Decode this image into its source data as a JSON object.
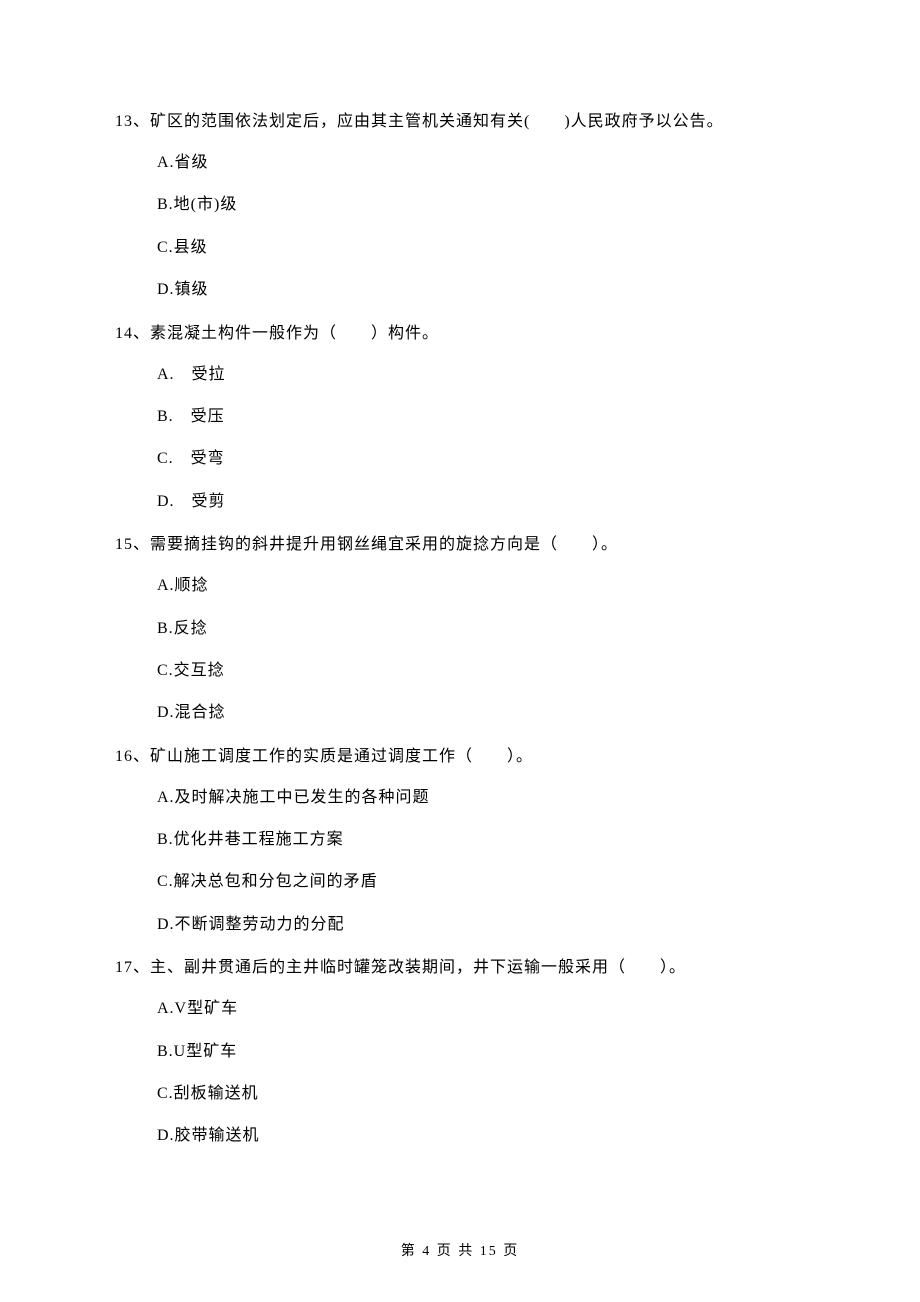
{
  "questions": [
    {
      "number": "13、",
      "stem": "矿区的范围依法划定后，应由其主管机关通知有关(　　)人民政府予以公告。",
      "options": [
        "A.省级",
        "B.地(市)级",
        "C.县级",
        "D.镇级"
      ]
    },
    {
      "number": "14、",
      "stem": "素混凝土构件一般作为（　　）构件。",
      "options": [
        "A.　受拉",
        "B.　受压",
        "C.　受弯",
        "D.　受剪"
      ]
    },
    {
      "number": "15、",
      "stem": "需要摘挂钩的斜井提升用钢丝绳宜采用的旋捻方向是（　　）。",
      "options": [
        "A.顺捻",
        "B.反捻",
        "C.交互捻",
        "D.混合捻"
      ]
    },
    {
      "number": "16、",
      "stem": "矿山施工调度工作的实质是通过调度工作（　　）。",
      "options": [
        "A.及时解决施工中已发生的各种问题",
        "B.优化井巷工程施工方案",
        "C.解决总包和分包之间的矛盾",
        "D.不断调整劳动力的分配"
      ]
    },
    {
      "number": "17、",
      "stem": "主、副井贯通后的主井临时罐笼改装期间，井下运输一般采用（　　）。",
      "options": [
        "A.V型矿车",
        "B.U型矿车",
        "C.刮板输送机",
        "D.胶带输送机"
      ]
    }
  ],
  "footer": "第 4 页 共 15 页"
}
